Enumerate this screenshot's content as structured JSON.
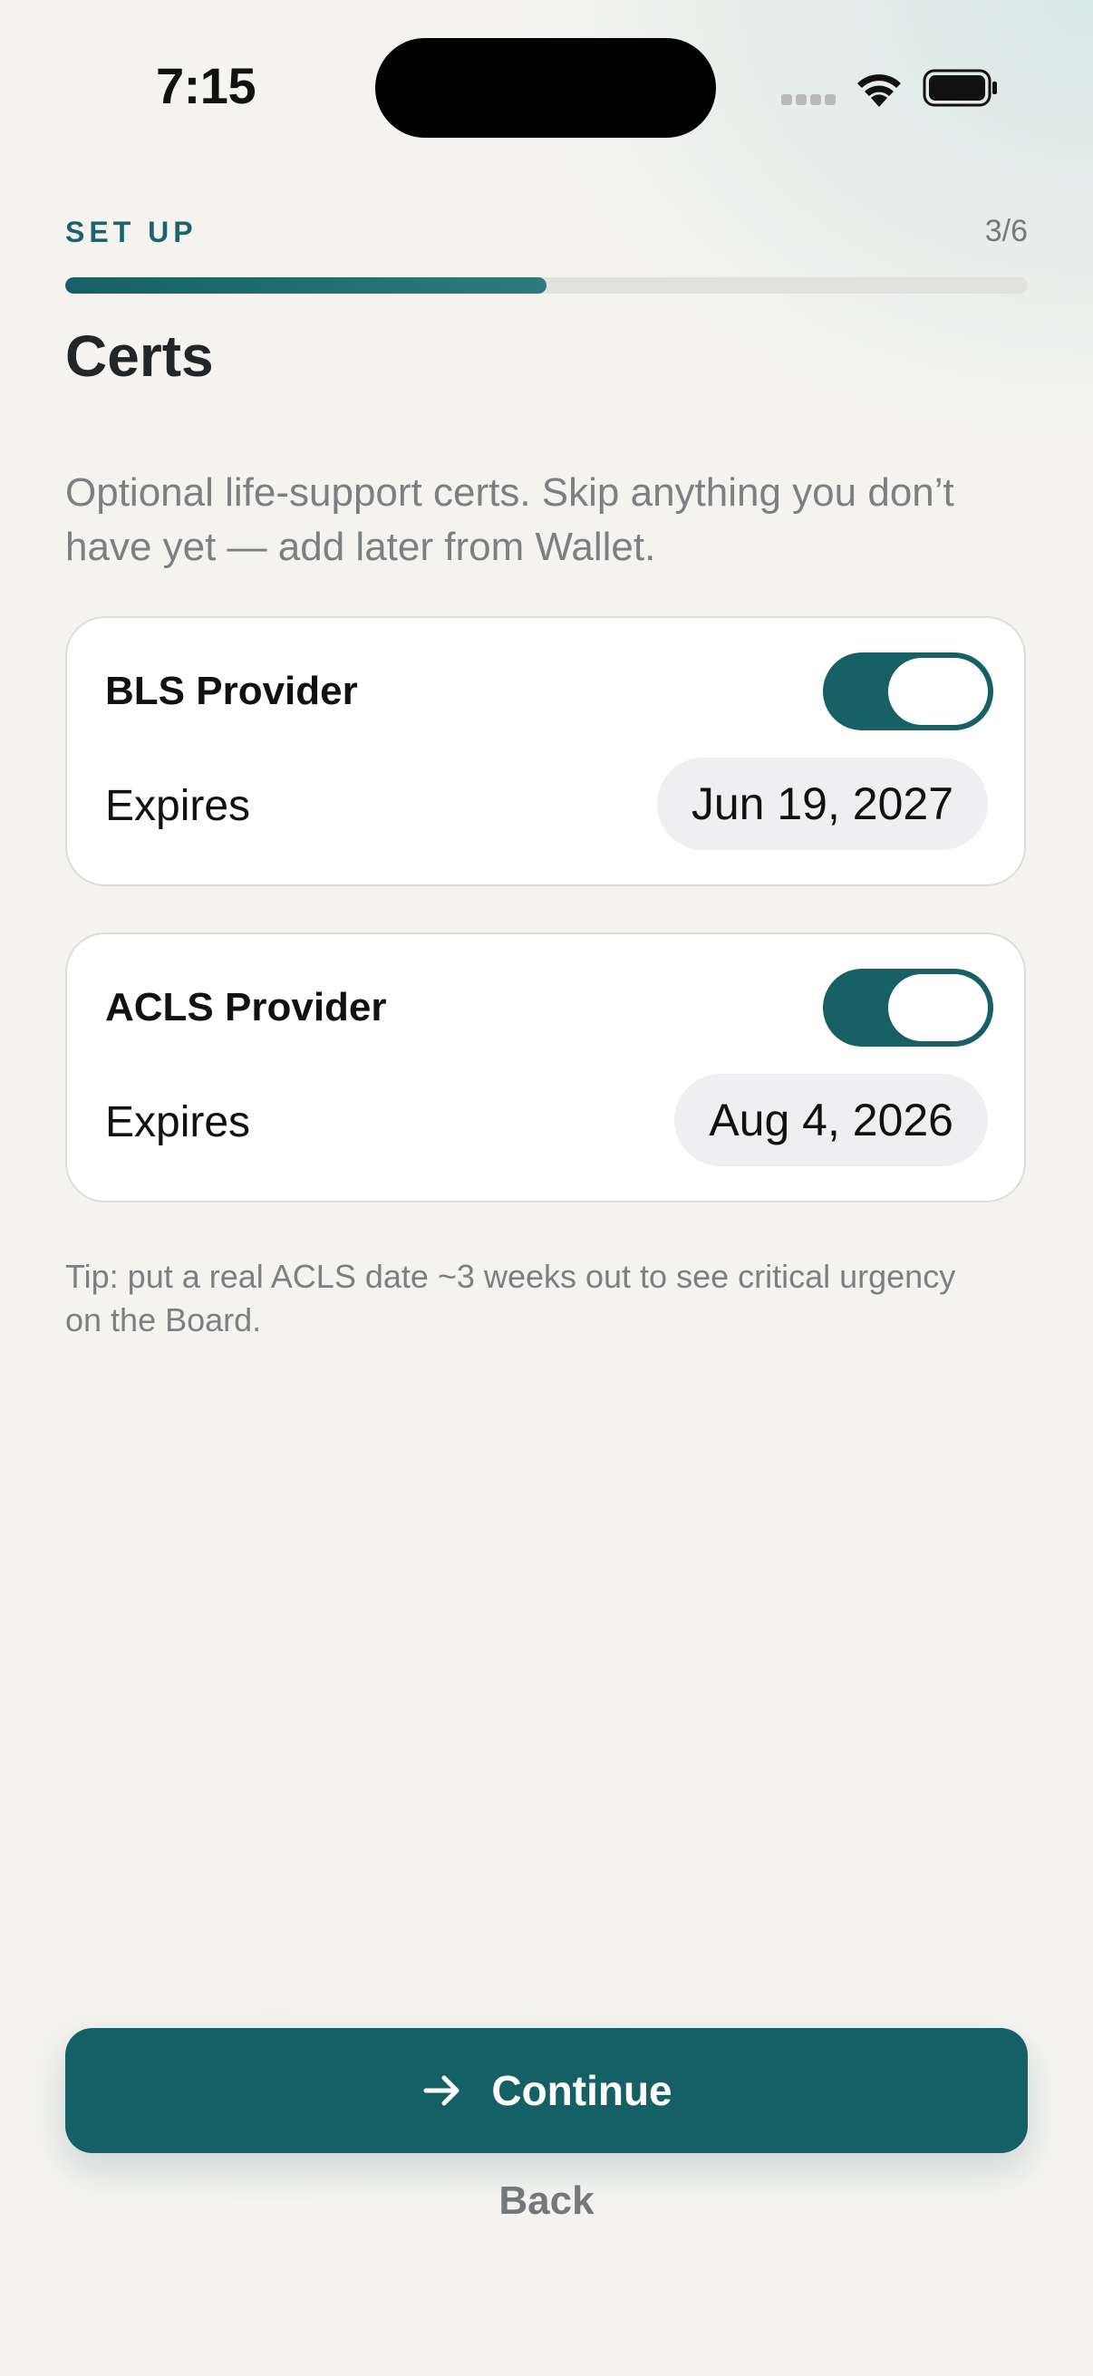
{
  "status_bar": {
    "time": "7:15",
    "icons": [
      "signal-dots-icon",
      "wifi-icon",
      "battery-icon"
    ]
  },
  "header": {
    "step_label": "SET UP",
    "step_count": "3/6",
    "progress": 0.5,
    "title": "Certs",
    "subtitle": "Optional life-support certs. Skip anything you don’t have yet — add later from Wallet."
  },
  "certs": [
    {
      "name": "BLS Provider",
      "enabled": true,
      "expires_label": "Expires",
      "expires_date": "Jun 19, 2027"
    },
    {
      "name": "ACLS Provider",
      "enabled": true,
      "expires_label": "Expires",
      "expires_date": "Aug 4, 2026"
    }
  ],
  "tip": "Tip: put a real ACLS date ~3 weeks out to see critical urgency on the Board.",
  "actions": {
    "continue_label": "Continue",
    "continue_icon": "arrow-right-icon",
    "back_label": "Back"
  },
  "colors": {
    "accent": "#156066",
    "background": "#f4f3f0",
    "secondary_text": "#7d8083"
  }
}
